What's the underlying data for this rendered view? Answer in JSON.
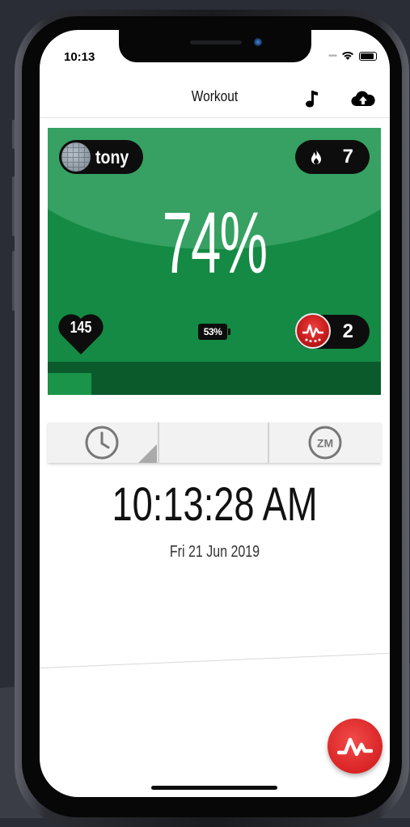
{
  "status_bar": {
    "time": "10:13"
  },
  "navbar": {
    "title": "Workout"
  },
  "card": {
    "user": {
      "name": "tony"
    },
    "streak": "7",
    "effort_percent": "74%",
    "heart_rate": "145",
    "battery": "53%",
    "hall_of_fame": "2",
    "progress_fraction": 0.13,
    "colors": {
      "main": "#148a44",
      "top": "#36a162",
      "bottom": "#0a5a2c"
    }
  },
  "tabs": [
    {
      "icon": "clock-icon"
    },
    {
      "icon": "blank"
    },
    {
      "icon": "zm-icon",
      "label": "ZM"
    }
  ],
  "clock": {
    "time": "10:13:28 AM",
    "date": "Fri 21 Jun 2019"
  },
  "fab": {
    "icon": "myzone-pulse-icon",
    "color": "#d92424"
  }
}
